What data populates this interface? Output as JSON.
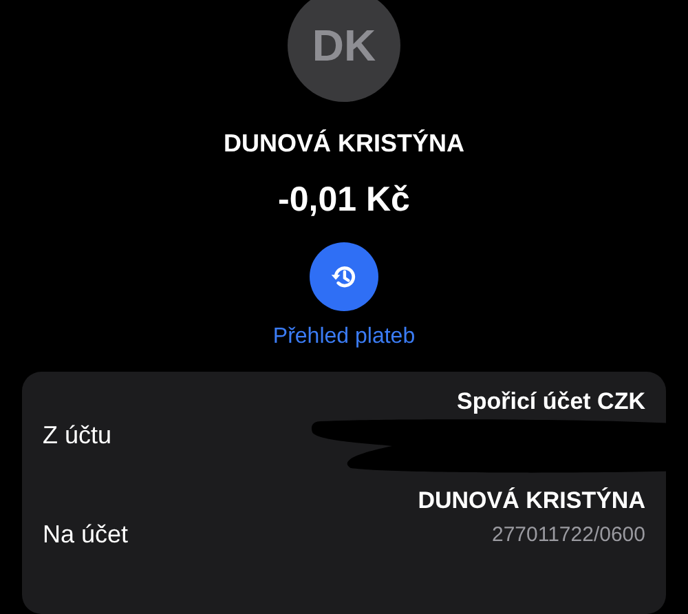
{
  "avatar": {
    "initials": "DK"
  },
  "recipient": {
    "name": "DUNOVÁ KRISTÝNA"
  },
  "amount": "-0,01 Kč",
  "history_link": {
    "label": "Přehled plateb"
  },
  "details": [
    {
      "label": "Z účtu",
      "value": "Spořicí účet CZK",
      "redacted": true
    },
    {
      "label": "Na účet",
      "value": "DUNOVÁ KRISTÝNA",
      "sub": "277011722/0600",
      "redacted": false
    }
  ]
}
